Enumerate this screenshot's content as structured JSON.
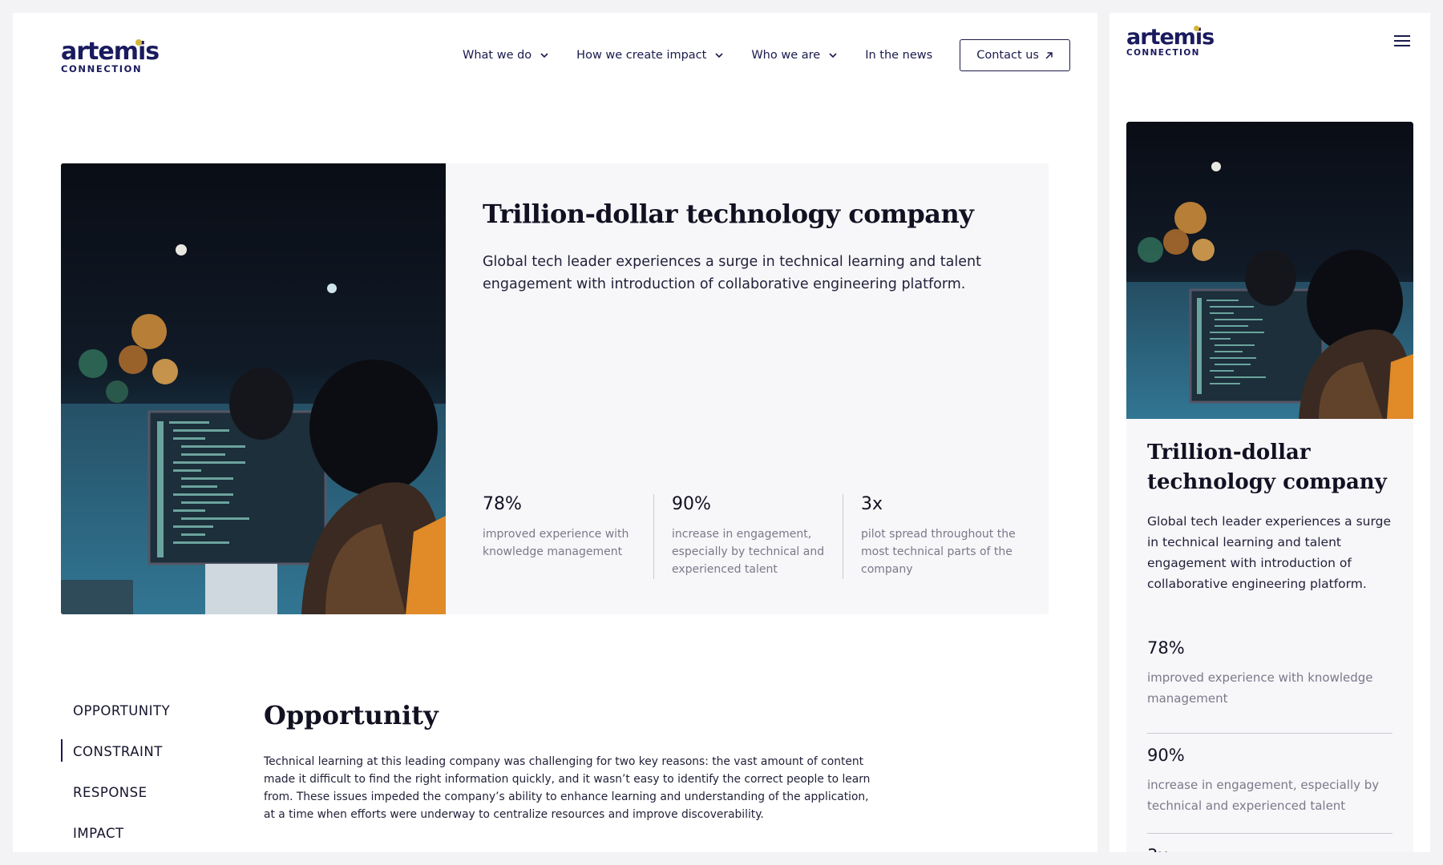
{
  "brand": {
    "name": "artemis",
    "sub": "CONNECTION"
  },
  "nav": {
    "items": [
      {
        "label": "What we do",
        "has_dropdown": true
      },
      {
        "label": "How we create impact",
        "has_dropdown": true
      },
      {
        "label": "Who we are",
        "has_dropdown": true
      },
      {
        "label": "In the news",
        "has_dropdown": false
      }
    ],
    "contact_label": "Contact us"
  },
  "case_study": {
    "title": "Trillion-dollar technology company",
    "description": "Global tech leader experiences a surge in technical learning and talent engagement with introduction of collaborative engineering platform.",
    "stats": [
      {
        "value": "78%",
        "label": "improved experience with knowledge management"
      },
      {
        "value": "90%",
        "label": "increase in engagement, especially by technical and experienced talent"
      },
      {
        "value": "3x",
        "label": "pilot spread throughout the most technical parts of the company"
      }
    ]
  },
  "toc": {
    "items": [
      "OPPORTUNITY",
      "CONSTRAINT",
      "RESPONSE",
      "IMPACT"
    ],
    "active": "CONSTRAINT"
  },
  "section": {
    "title": "Opportunity",
    "body": "Technical learning at this leading company was challenging for two key reasons: the vast amount of content made it difficult to find the right information quickly, and it wasn’t easy to identify the correct people to learn from. These issues impeded the company’s ability to enhance learning and understanding of the application, at a time when efforts were underway to centralize resources and improve discoverability."
  },
  "colors": {
    "brand_navy": "#1a1a5e",
    "brand_gold": "#d4b73a",
    "card_bg": "#f7f6f9",
    "muted_text": "#7a7a8a"
  },
  "icons": {
    "dropdown": "chevron-down-icon",
    "external": "arrow-up-right-icon",
    "menu": "hamburger-menu-icon"
  }
}
